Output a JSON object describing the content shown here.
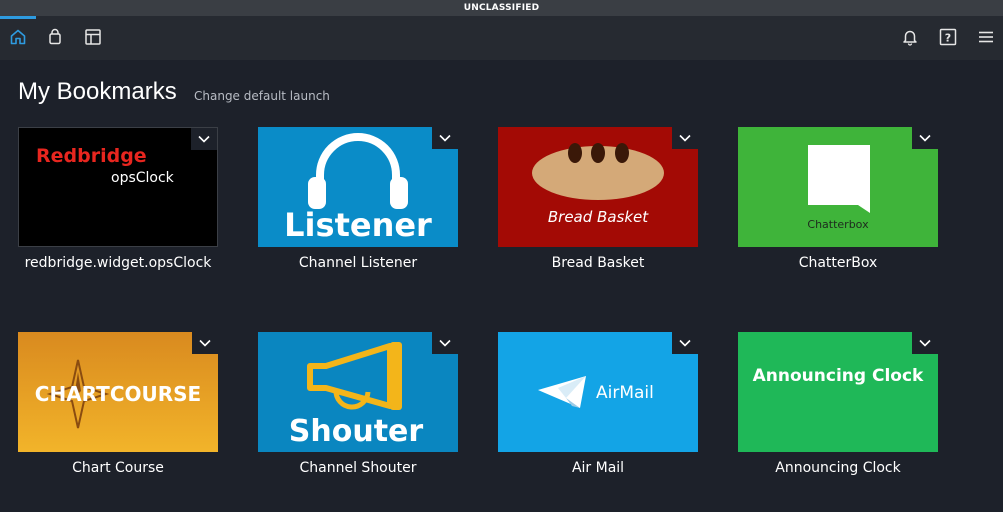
{
  "classification_banner": "UNCLASSIFIED",
  "nav": {
    "left_icons": [
      "home-icon",
      "bag-icon",
      "layout-icon"
    ],
    "right_icons": [
      "bell-icon",
      "help-icon",
      "menu-icon"
    ],
    "help_glyph": "?"
  },
  "header": {
    "title": "My Bookmarks",
    "change_link": "Change default launch"
  },
  "bookmarks": [
    {
      "label": "redbridge.widget.opsClock",
      "line1": "Redbridge",
      "line2": "opsClock",
      "bg": "#000000",
      "accent": "#e8261f"
    },
    {
      "label": "Channel Listener",
      "art_text": "Listener",
      "bg": "#0a8cc8"
    },
    {
      "label": "Bread Basket",
      "art_text": "Bread Basket",
      "bg": "#a30a05",
      "accent": "#d4a978"
    },
    {
      "label": "ChatterBox",
      "art_text": "Chatterbox",
      "bg": "#3fb43a"
    },
    {
      "label": "Chart Course",
      "art_text": "CHARTCOURSE",
      "bg": "#e29a1e"
    },
    {
      "label": "Channel Shouter",
      "art_text": "Shouter",
      "bg": "#0a86c0",
      "accent": "#f3b51a"
    },
    {
      "label": "Air Mail",
      "art_text": "AirMail",
      "bg": "#13a4e6"
    },
    {
      "label": "Announcing Clock",
      "art_text": "Announcing Clock",
      "bg": "#1fb858"
    }
  ],
  "colors": {
    "background": "#1d212a",
    "nav_bar": "#262a31",
    "active_accent": "#2e9be0",
    "banner": "#3a3e44"
  }
}
